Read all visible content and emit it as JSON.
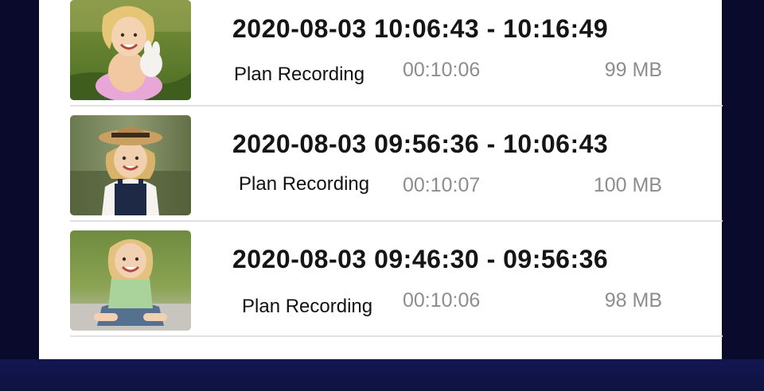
{
  "recordings": [
    {
      "date_time_range": "2020-08-03  10:06:43 - 10:16:49",
      "type_label": "Plan Recording",
      "duration": "00:10:06",
      "file_size": "99 MB"
    },
    {
      "date_time_range": "2020-08-03  09:56:36 - 10:06:43",
      "type_label": "Plan Recording",
      "duration": "00:10:07",
      "file_size": "100 MB"
    },
    {
      "date_time_range": "2020-08-03  09:46:30 - 09:56:36",
      "type_label": "Plan Recording",
      "duration": "00:10:06",
      "file_size": "98 MB"
    }
  ]
}
